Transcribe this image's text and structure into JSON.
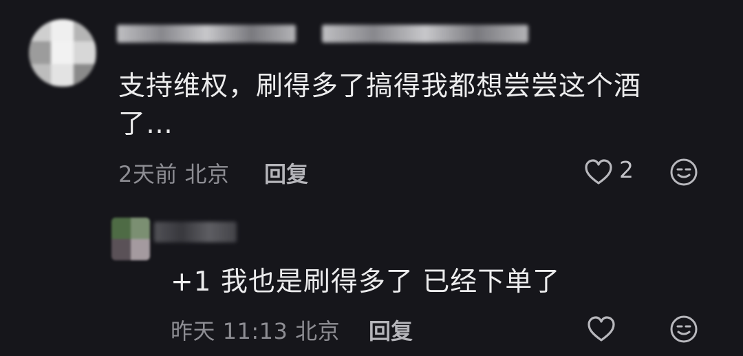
{
  "comments": [
    {
      "text_line1": "支持维权，刷得多了搞得我都想尝尝这个酒",
      "text_line2": "了…",
      "meta": "2天前 北京",
      "reply_label": "回复",
      "like_count": "2",
      "like_icon": "heart-outline-icon",
      "reaction_icon": "smiley-face-icon"
    }
  ],
  "replies": [
    {
      "text": "+1 我也是刷得多了 已经下单了",
      "meta": "昨天 11:13 北京",
      "reply_label": "回复",
      "like_icon": "heart-outline-icon",
      "reaction_icon": "smiley-face-icon"
    }
  ],
  "colors": {
    "background": "#16161b",
    "text": "#ececed",
    "meta": "#8d8d93"
  }
}
